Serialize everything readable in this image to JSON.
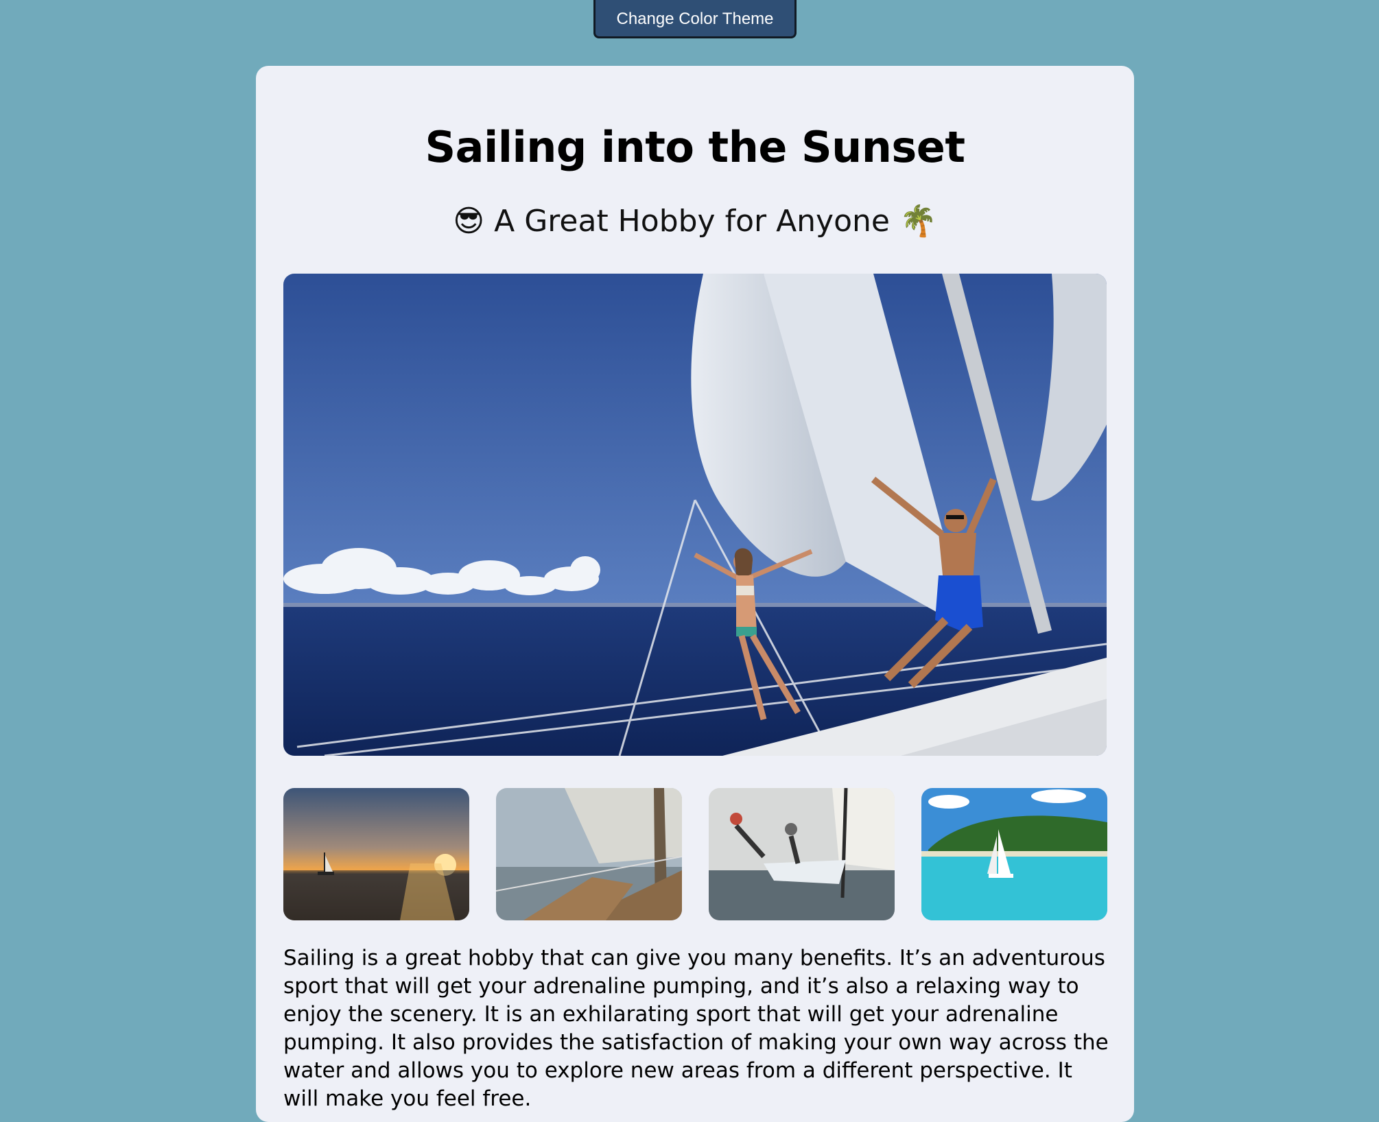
{
  "theme_button": {
    "label": "Change Color Theme"
  },
  "header": {
    "title": "Sailing into the Sunset",
    "subtitle": "A Great Hobby for Anyone",
    "subtitle_emoji_left": "😎",
    "subtitle_emoji_right": "🌴"
  },
  "colors": {
    "page_background": "#71aabb",
    "card_background": "#eef0f7",
    "button_background": "#2f4f75"
  },
  "body": {
    "paragraph": "Sailing is a great hobby that can give you many benefits. It’s an adventurous sport that will get your adrenaline pumping, and it’s also a relaxing way to enjoy the scenery. It is an exhilarating sport that will get your adrenaline pumping. It also provides the satisfaction of making your own way across the water and allows you to explore new areas from a different perspective. It will make you feel free."
  }
}
